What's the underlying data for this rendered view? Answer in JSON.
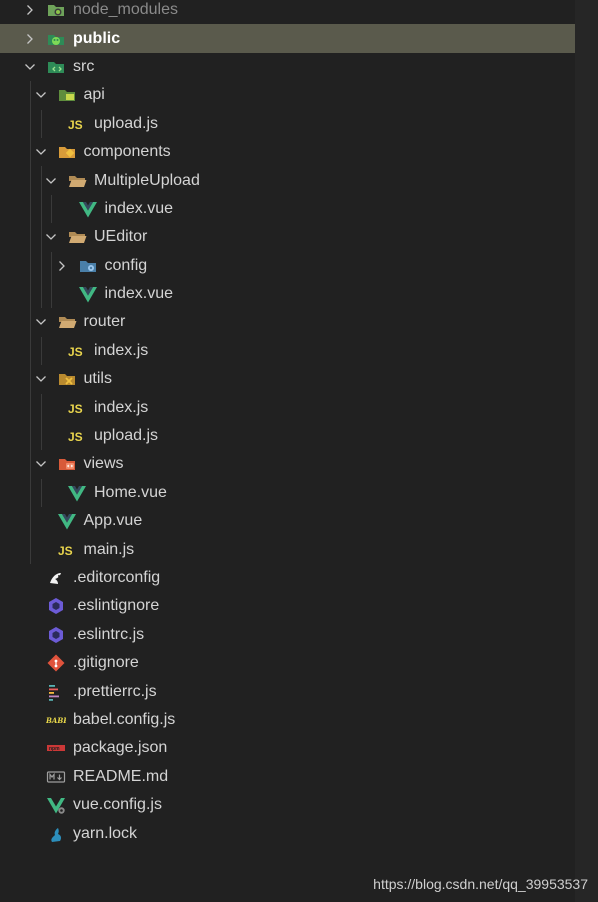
{
  "explorer": {
    "items": [
      {
        "label": "node_modules",
        "icon": "node-modules-folder-icon",
        "chevron": "collapsed",
        "depth": 0,
        "state": "dim"
      },
      {
        "label": "public",
        "icon": "public-folder-icon",
        "chevron": "collapsed",
        "depth": 0,
        "state": "selected"
      },
      {
        "label": "src",
        "icon": "src-folder-icon",
        "chevron": "expanded",
        "depth": 0
      },
      {
        "label": "api",
        "icon": "api-folder-icon",
        "chevron": "expanded",
        "depth": 1
      },
      {
        "label": "upload.js",
        "icon": "js-file-icon",
        "depth": 2
      },
      {
        "label": "components",
        "icon": "components-folder-icon",
        "chevron": "expanded",
        "depth": 1
      },
      {
        "label": "MultipleUpload",
        "icon": "folder-open-icon",
        "chevron": "expanded",
        "depth": 2
      },
      {
        "label": "index.vue",
        "icon": "vue-file-icon",
        "depth": 3
      },
      {
        "label": "UEditor",
        "icon": "folder-open-icon",
        "chevron": "expanded",
        "depth": 2
      },
      {
        "label": "config",
        "icon": "config-folder-icon",
        "chevron": "collapsed",
        "depth": 3
      },
      {
        "label": "index.vue",
        "icon": "vue-file-icon",
        "depth": 3
      },
      {
        "label": "router",
        "icon": "folder-open-icon",
        "chevron": "expanded",
        "depth": 1
      },
      {
        "label": "index.js",
        "icon": "js-file-icon",
        "depth": 2
      },
      {
        "label": "utils",
        "icon": "utils-folder-icon",
        "chevron": "expanded",
        "depth": 1
      },
      {
        "label": "index.js",
        "icon": "js-file-icon",
        "depth": 2
      },
      {
        "label": "upload.js",
        "icon": "js-file-icon",
        "depth": 2
      },
      {
        "label": "views",
        "icon": "views-folder-icon",
        "chevron": "expanded",
        "depth": 1
      },
      {
        "label": "Home.vue",
        "icon": "vue-file-icon",
        "depth": 2
      },
      {
        "label": "App.vue",
        "icon": "vue-file-icon",
        "depth": 1
      },
      {
        "label": "main.js",
        "icon": "js-file-icon",
        "depth": 1
      },
      {
        "label": ".editorconfig",
        "icon": "editorconfig-file-icon",
        "depth": 0
      },
      {
        "label": ".eslintignore",
        "icon": "eslint-file-icon",
        "depth": 0
      },
      {
        "label": ".eslintrc.js",
        "icon": "eslint-file-icon",
        "depth": 0
      },
      {
        "label": ".gitignore",
        "icon": "git-file-icon",
        "depth": 0
      },
      {
        "label": ".prettierrc.js",
        "icon": "prettier-file-icon",
        "depth": 0
      },
      {
        "label": "babel.config.js",
        "icon": "babel-file-icon",
        "depth": 0
      },
      {
        "label": "package.json",
        "icon": "npm-file-icon",
        "depth": 0
      },
      {
        "label": "README.md",
        "icon": "markdown-file-icon",
        "depth": 0
      },
      {
        "label": "vue.config.js",
        "icon": "vue-config-file-icon",
        "depth": 0
      },
      {
        "label": "yarn.lock",
        "icon": "yarn-file-icon",
        "depth": 0
      }
    ]
  },
  "watermark": "https://blog.csdn.net/qq_39953537",
  "colors": {
    "background": "#212121",
    "selected_row": "#5a5a4c",
    "vue_green": "#41b883",
    "js_yellow": "#e8d44d",
    "folder_tan": "#c9a66b"
  }
}
